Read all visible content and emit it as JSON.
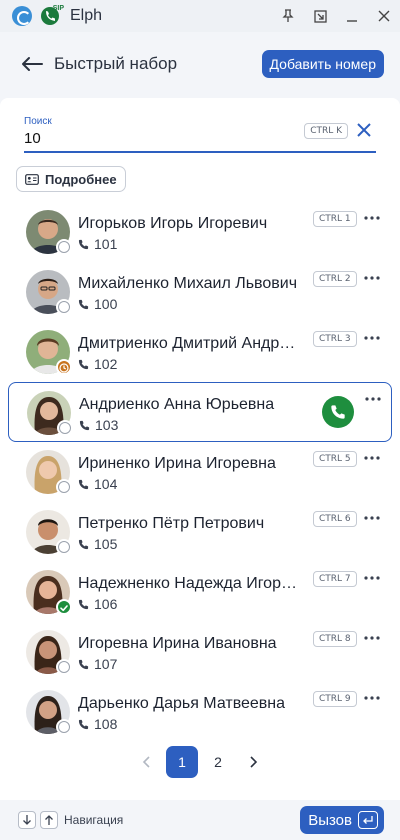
{
  "titlebar": {
    "app_title": "Elph",
    "sip_badge": "SIP",
    "icons": [
      "app-logo",
      "sip-phone-icon",
      "pin-icon",
      "resize-icon",
      "minimize-icon",
      "close-icon"
    ]
  },
  "header": {
    "title": "Быстрый набор",
    "add_button": "Добавить номер"
  },
  "search": {
    "label": "Поиск",
    "value": "10",
    "shortcut": "CTRL K"
  },
  "details_button": "Подробнее",
  "contacts": [
    {
      "name": "Игорьков Игорь Игоревич",
      "ext": "101",
      "shortcut": "CTRL 1",
      "status": "offline"
    },
    {
      "name": "Михайленко Михаил Львович",
      "ext": "100",
      "shortcut": "CTRL 2",
      "status": "offline"
    },
    {
      "name": "Дмитриенко Дмитрий Андреевич",
      "ext": "102",
      "shortcut": "CTRL 3",
      "status": "away"
    },
    {
      "name": "Андриенко Анна Юрьевна",
      "ext": "103",
      "shortcut": "",
      "status": "offline",
      "selected": true
    },
    {
      "name": "Ириненко Ирина Игоревна",
      "ext": "104",
      "shortcut": "CTRL 5",
      "status": "offline"
    },
    {
      "name": "Петренко Пётр Петрович",
      "ext": "105",
      "shortcut": "CTRL 6",
      "status": "offline"
    },
    {
      "name": "Надежненко Надежда Игоревна",
      "ext": "106",
      "shortcut": "CTRL 7",
      "status": "online"
    },
    {
      "name": "Игоревна Ирина Ивановна",
      "ext": "107",
      "shortcut": "CTRL 8",
      "status": "offline"
    },
    {
      "name": "Дарьенко Дарья Матвеевна",
      "ext": "108",
      "shortcut": "CTRL 9",
      "status": "offline"
    }
  ],
  "pagination": {
    "pages": [
      "1",
      "2"
    ],
    "current": "1"
  },
  "footer": {
    "nav_label": "Навигация",
    "call_button": "Вызов"
  },
  "colors": {
    "accent": "#2d5fc0",
    "call_green": "#1e8e3e",
    "away": "#c8741f"
  }
}
